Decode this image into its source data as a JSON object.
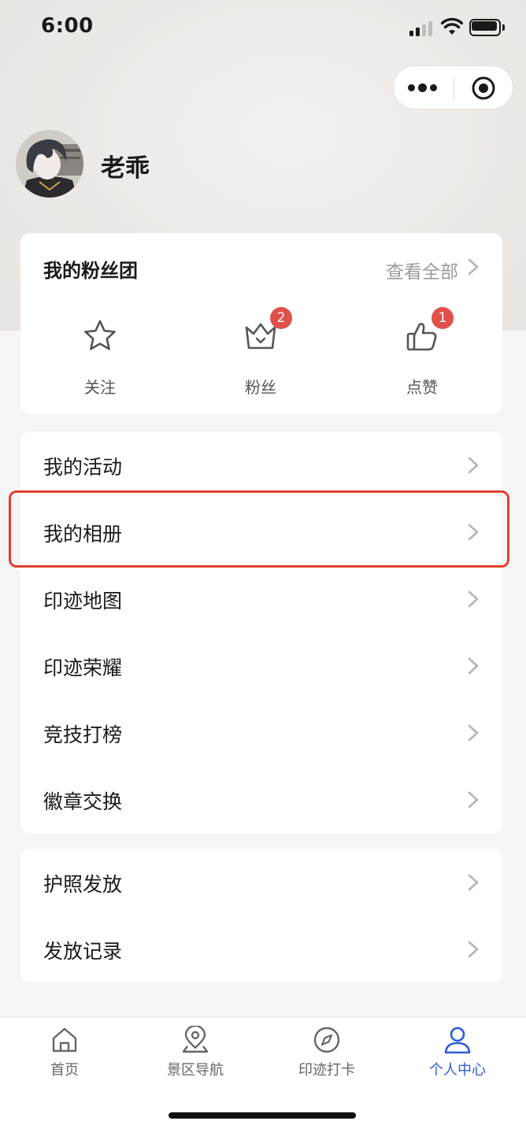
{
  "status_bar": {
    "time": "6:00"
  },
  "profile": {
    "name": "老乖"
  },
  "fans_card": {
    "title": "我的粉丝团",
    "view_all": "查看全部",
    "items": [
      {
        "label": "关注",
        "icon": "star-icon",
        "badge": null
      },
      {
        "label": "粉丝",
        "icon": "crown-icon",
        "badge": "2"
      },
      {
        "label": "点赞",
        "icon": "thumbs-up-icon",
        "badge": "1"
      }
    ]
  },
  "menu_group_1": [
    {
      "label": "我的活动"
    },
    {
      "label": "我的相册"
    },
    {
      "label": "印迹地图"
    },
    {
      "label": "印迹荣耀"
    },
    {
      "label": "竞技打榜"
    },
    {
      "label": "徽章交换"
    }
  ],
  "menu_group_2": [
    {
      "label": "护照发放"
    },
    {
      "label": "发放记录"
    }
  ],
  "tab_bar": {
    "tabs": [
      {
        "label": "首页",
        "icon": "home-icon"
      },
      {
        "label": "景区导航",
        "icon": "location-pin-icon"
      },
      {
        "label": "印迹打卡",
        "icon": "compass-icon"
      },
      {
        "label": "个人中心",
        "icon": "person-icon"
      }
    ],
    "active_tab": "个人中心"
  },
  "colors": {
    "accent": "#2a5bd7",
    "badge": "#e0504a",
    "highlight_border": "#e0402f",
    "secondary_text": "#9a9a9a"
  }
}
